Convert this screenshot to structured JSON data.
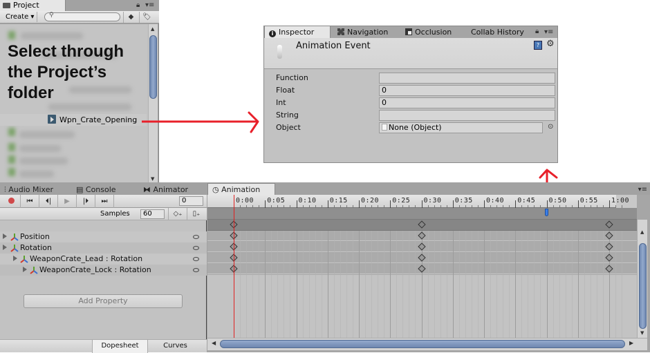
{
  "project_panel": {
    "tab_label": "Project",
    "create_label": "Create ▾",
    "search_placeholder": "",
    "annotation": "Select through the Project’s folder",
    "selected_asset": "Wpn_Crate_Opening",
    "partial_folder_label": "Models"
  },
  "inspector": {
    "tabs": [
      {
        "label": "Inspector",
        "icon": "info-icon",
        "active": true
      },
      {
        "label": "Navigation",
        "icon": "navigation-icon",
        "active": false
      },
      {
        "label": "Occlusion",
        "icon": "occlusion-icon",
        "active": false
      },
      {
        "label": "Collab History",
        "icon": "",
        "active": false
      }
    ],
    "title": "Animation Event",
    "fields": [
      {
        "label": "Function",
        "value": ""
      },
      {
        "label": "Float",
        "value": "0"
      },
      {
        "label": "Int",
        "value": "0"
      },
      {
        "label": "String",
        "value": ""
      },
      {
        "label": "Object",
        "value": "None (Object)"
      }
    ]
  },
  "animation_window": {
    "tabs": [
      {
        "label": "Audio Mixer",
        "icon": "audio-mixer-icon"
      },
      {
        "label": "Console",
        "icon": "console-icon"
      },
      {
        "label": "Animator",
        "icon": "animator-icon"
      },
      {
        "label": "Animation",
        "icon": "clock-icon",
        "active": true
      }
    ],
    "current_frame": "0",
    "samples_label": "Samples",
    "samples_value": "60",
    "properties": [
      {
        "name": "Position",
        "indent": 0
      },
      {
        "name": "Rotation",
        "indent": 0
      },
      {
        "name": "WeaponCrate_Lead : Rotation",
        "indent": 1
      },
      {
        "name": "WeaponCrate_Lock : Rotation",
        "indent": 2
      }
    ],
    "add_property_label": "Add Property",
    "view_tabs": [
      {
        "label": "Dopesheet",
        "active": true
      },
      {
        "label": "Curves",
        "active": false
      }
    ],
    "timeline": {
      "tick_labels": [
        "0:00",
        "0:05",
        "0:10",
        "0:15",
        "0:20",
        "0:25",
        "0:30",
        "0:35",
        "0:40",
        "0:45",
        "0:50",
        "0:55",
        "1:00"
      ],
      "keyframe_times_seconds": [
        0,
        30,
        60
      ],
      "playhead_time_seconds": 0,
      "event_marker_time_seconds": 50,
      "clip_end_seconds": 60
    }
  },
  "annotations": {
    "arrow_color": "#e8202a"
  }
}
